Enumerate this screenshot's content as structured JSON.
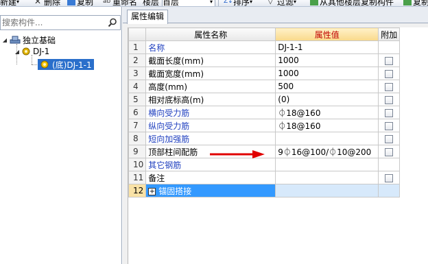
{
  "toolbar": {
    "items": [
      "新建",
      "删除",
      "复制",
      "重命名",
      "楼层",
      "首层",
      "排序",
      "过滤",
      "从其他楼层复制构件",
      "复制"
    ]
  },
  "left": {
    "search_placeholder": "搜索构件...",
    "tree": {
      "root": "独立基础",
      "child": "DJ-1",
      "leaf": "(底)DJ-1-1"
    }
  },
  "right": {
    "tab_label": "属性编辑",
    "columns": [
      "属性名称",
      "属性值",
      "附加"
    ],
    "rows": [
      {
        "n": "1",
        "name": "名称",
        "value": "DJ-1-1",
        "blue": true,
        "check": false
      },
      {
        "n": "2",
        "name": "截面长度(mm)",
        "value": "1000",
        "blue": false,
        "check": true
      },
      {
        "n": "3",
        "name": "截面宽度(mm)",
        "value": "1000",
        "blue": false,
        "check": true
      },
      {
        "n": "4",
        "name": "高度(mm)",
        "value": "500",
        "blue": false,
        "check": true
      },
      {
        "n": "5",
        "name": "相对底标高(m)",
        "value": "(0)",
        "blue": false,
        "check": true
      },
      {
        "n": "6",
        "name": "横向受力筋",
        "value": "⏀18@160",
        "blue": true,
        "check": true
      },
      {
        "n": "7",
        "name": "纵向受力筋",
        "value": "⏀18@160",
        "blue": true,
        "check": true
      },
      {
        "n": "8",
        "name": "短向加强筋",
        "value": "",
        "blue": true,
        "check": true
      },
      {
        "n": "9",
        "name": "顶部柱间配筋",
        "value": "9⏀16@100/⏀10@200",
        "blue": false,
        "check": true
      },
      {
        "n": "10",
        "name": "其它钢筋",
        "value": "",
        "blue": true,
        "check": false
      },
      {
        "n": "11",
        "name": "备注",
        "value": "",
        "blue": false,
        "check": true
      },
      {
        "n": "12",
        "name": "锚固搭接",
        "value": "",
        "blue": false,
        "check": false,
        "expandable": true,
        "selected": true
      }
    ]
  },
  "colors": {
    "selection": "#3399ff",
    "value_header_text": "#c00000",
    "blue_text": "#1f3fbf",
    "arrow": "#e00000"
  }
}
